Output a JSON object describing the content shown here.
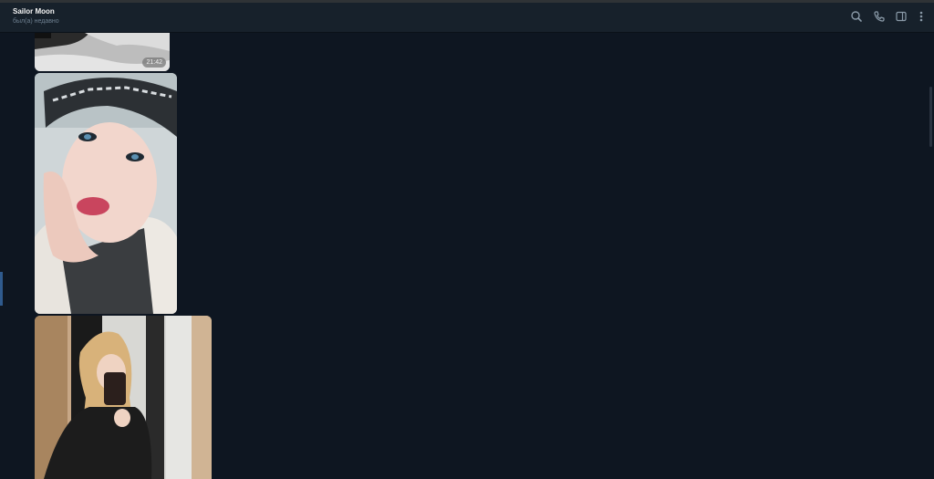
{
  "header": {
    "title": "Sailor Moon",
    "status": "был(а) недавно",
    "actions": [
      "search-icon",
      "phone-icon",
      "sidebar-toggle-icon",
      "more-vertical-icon"
    ]
  },
  "messages": [
    {
      "type": "photo",
      "time": "21:42"
    },
    {
      "type": "photo"
    },
    {
      "type": "photo"
    }
  ],
  "colors": {
    "background": "#0e1621",
    "header": "#17212b",
    "accent": "#2f5a8d"
  }
}
